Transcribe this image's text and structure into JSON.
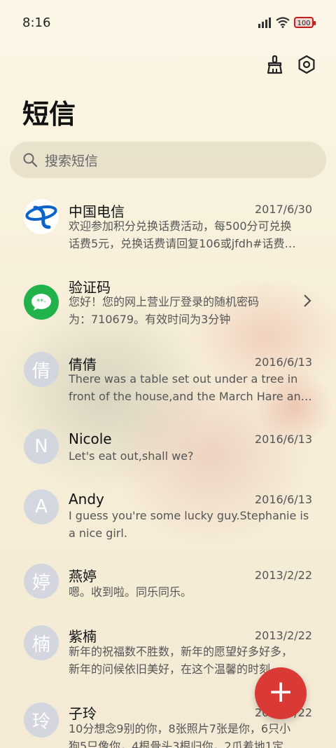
{
  "status": {
    "time": "8:16",
    "battery": "100"
  },
  "header": {
    "title": "短信"
  },
  "search": {
    "placeholder": "搜索短信"
  },
  "messages": [
    {
      "name": "中国电信",
      "date": "2017/6/30",
      "line1": "欢迎参加积分兑换话费活动，每500分可兑换",
      "line2": "话费5元，兑换话费请回复106或jfdh#话费…",
      "avatar": "telecom-logo"
    },
    {
      "name": "验证码",
      "date": "",
      "line1": "您好！您的网上营业厅登录的随机密码",
      "line2": "为：710679。有效时间为3分钟",
      "avatar": "message-bubble"
    },
    {
      "name": "倩倩",
      "date": "2016/6/13",
      "line1": "There was a table set out under a tree in",
      "line2": "front of the house,and the March Hare an…",
      "avatar": "倩"
    },
    {
      "name": "Nicole",
      "date": "2016/6/13",
      "line1": "Let's eat out,shall we?",
      "line2": "",
      "avatar": "N"
    },
    {
      "name": "Andy",
      "date": "2016/6/13",
      "line1": "I guess you're some lucky guy.Stephanie is",
      "line2": "a nice girl.",
      "avatar": "A"
    },
    {
      "name": "燕婷",
      "date": "2013/2/22",
      "line1": "嗯。收到啦。同乐同乐。",
      "line2": "",
      "avatar": "婷"
    },
    {
      "name": "紫楠",
      "date": "2013/2/22",
      "line1": "新年的祝福数不胜数，新年的愿望好多好多，",
      "line2": "新年的问候依旧美好，在这个温馨的时刻…",
      "avatar": "楠"
    },
    {
      "name": "子玲",
      "date": "2013/2/22",
      "line1": "10分想念9别的你，8张照片7张是你，6只小",
      "line2": "狗5只像你，4根骨头3根归你，2爪着地1定",
      "avatar": "玲"
    }
  ],
  "fab": {
    "label": "+"
  },
  "colors": {
    "accent": "#d93a36",
    "telecom": "#0a64c8",
    "bubble_green": "#22b24c"
  }
}
